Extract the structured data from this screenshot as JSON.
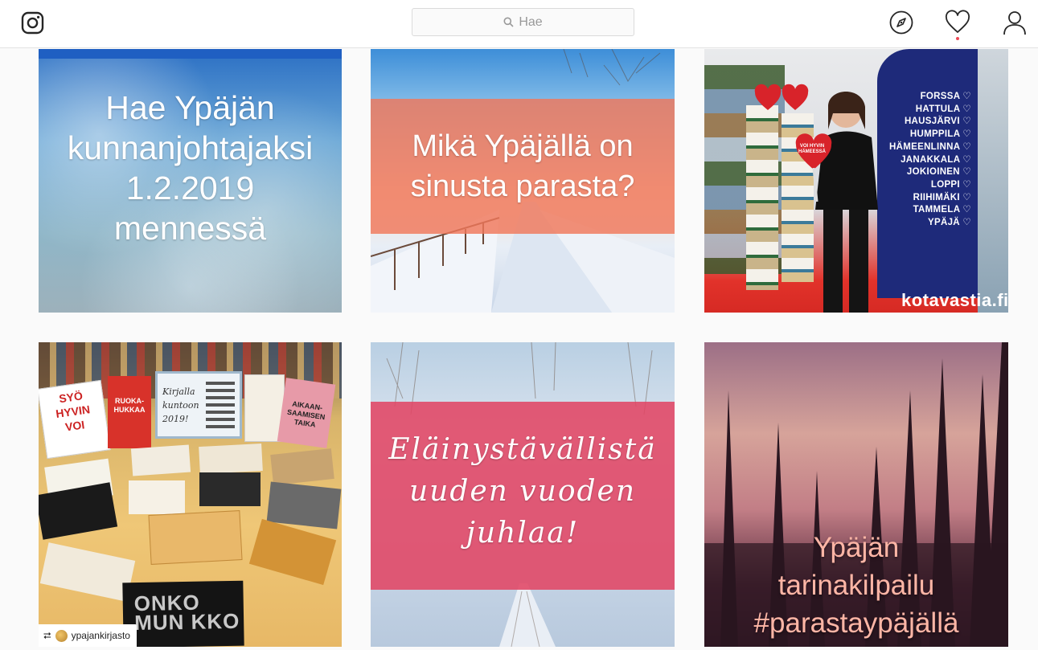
{
  "header": {
    "search": {
      "placeholder": "Hae"
    },
    "icons": [
      "instagram-logo-icon",
      "explore-compass-icon",
      "activity-heart-icon",
      "profile-icon"
    ],
    "notification_dot_color": "#ed4956"
  },
  "posts": [
    {
      "text_lines": [
        "Hae Ypäjän",
        "kunnanjohtajaksi",
        "1.2.2019",
        "mennessä"
      ]
    },
    {
      "text_lines": [
        "Mikä Ypäjällä on",
        "sinusta parasta?"
      ]
    },
    {
      "banner_lines": [
        "FORSSA ♡",
        "HATTULA ♡",
        "HAUSJÄRVI ♡",
        "HUMPPILA ♡",
        "HÄMEENLINNA ♡",
        "JANAKKALA ♡",
        "JOKIOINEN ♡",
        "LOPPI ♡",
        "RIIHIMÄKI ♡",
        "TAMMELA ♡",
        "YPÄJÄ ♡"
      ],
      "heart_sign": [
        "VOI HYVIN",
        "HÄMEESSÄ"
      ],
      "footer_text": "kotavastia.fi"
    },
    {
      "book_covers": [
        "SYÖ HYVIN VOI",
        "RUOKA-HUKKAA",
        "Kirjalla kuntoon 2019!",
        "AIKAAN-SAAMISEN TAIKA",
        "ONKO MUN KKO"
      ],
      "repost": {
        "username": "ypajankirjasto"
      }
    },
    {
      "text_lines": [
        "Eläinystävällistä",
        "uuden vuoden",
        "juhlaa!"
      ]
    },
    {
      "text_lines": [
        "Ypäjän",
        "tarinakilpailu",
        "#parastaypäjällä"
      ]
    }
  ],
  "colors": {
    "accent_salmon": "#f28a6e",
    "accent_pink": "#e4506f",
    "banner_blue": "#1e2a7a"
  }
}
